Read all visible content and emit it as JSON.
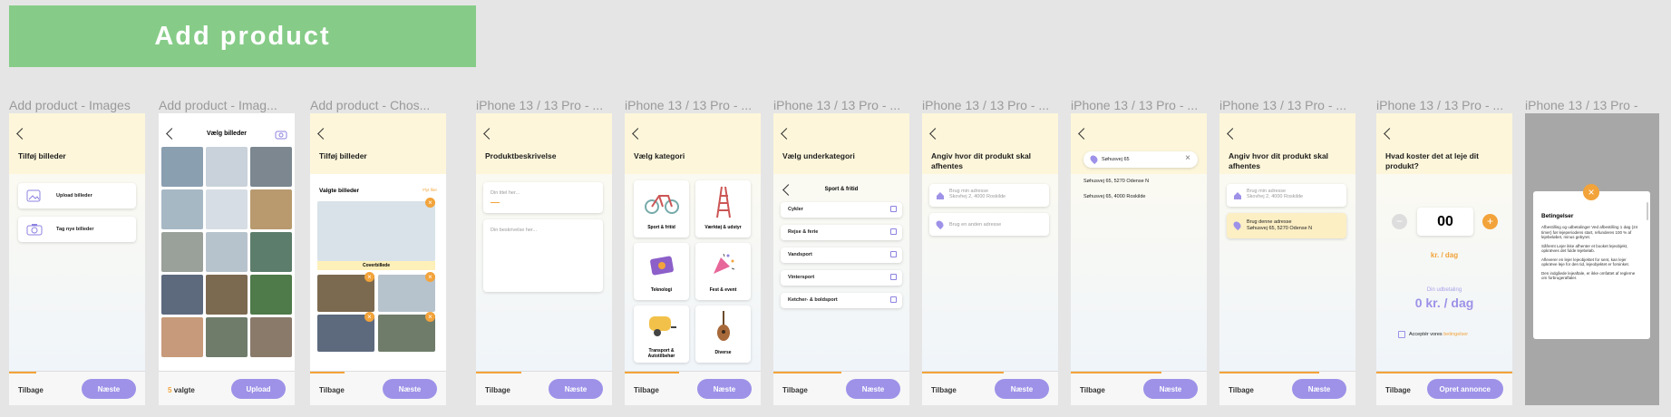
{
  "banner": "Add product",
  "frame_titles": [
    "Add product - Images",
    "Add product - Imag...",
    "Add product - Chos...",
    "iPhone 13 / 13 Pro - ...",
    "iPhone 13 / 13 Pro - ...",
    "iPhone 13 / 13 Pro - ...",
    "iPhone 13 / 13 Pro - ...",
    "iPhone 13 / 13 Pro - ...",
    "iPhone 13 / 13 Pro - ...",
    "iPhone 13 / 13 Pro - ...",
    "iPhone 13 / 13 Pro - "
  ],
  "footer": {
    "back": "Tilbage",
    "next": "Næste",
    "upload": "Upload",
    "publish": "Opret annonce",
    "selected_count": "5",
    "selected_word": "valgte"
  },
  "s1": {
    "title": "Tilføj billeder",
    "upload": "Upload billeder",
    "take": "Tag nye billeder"
  },
  "s2": {
    "title": "Vælg billeder"
  },
  "s3": {
    "title": "Tilføj billeder",
    "section": "Valgte billeder",
    "edit": "Flyt filer",
    "cover": "Coverbillede"
  },
  "s4": {
    "title": "Produktbeskrivelse",
    "title_ph": "Din titel her...",
    "desc_ph": "Din beskrivelse her..."
  },
  "s5": {
    "title": "Vælg kategori",
    "cats": [
      "Sport & fritid",
      "Værktøj & udstyr",
      "Teknologi",
      "Fest & event",
      "Transport & Autotilbehør",
      "Diverse"
    ]
  },
  "s6": {
    "title": "Vælg underkategori",
    "group": "Sport & fritid",
    "items": [
      "Cykler",
      "Rejse & ferie",
      "Vandsport",
      "Vintersport",
      "Ketcher- & boldsport"
    ]
  },
  "s7": {
    "title": "Angiv hvor dit produkt skal afhentes",
    "addr_title": "Brug min adresse",
    "addr_sub": "Skovhej 2, 4000 Roskilde",
    "other": "Brug en anden adresse"
  },
  "s8": {
    "search": "Søhusvej 65",
    "results": [
      "Søhusvej 65, 5270 Odense N",
      "Søhusvej 65, 4000 Roskilde"
    ]
  },
  "s9": {
    "title": "Angiv hvor dit produkt skal afhentes",
    "addr_title": "Brug min adresse",
    "addr_sub": "Skovhej 2, 4000 Roskilde",
    "sel_title": "Brug denne adresse",
    "sel_sub": "Søhusvej 65, 5270 Odense N"
  },
  "s10": {
    "title": "Hvad koster det at leje dit produkt?",
    "price": "00",
    "unit": "kr. / dag",
    "payout_label": "Din udbetaling",
    "payout": "0 kr. / dag",
    "accept": "Acceptér vores",
    "terms": "betingelser"
  },
  "s11": {
    "title": "Betingelser",
    "p1": "Afbestilling og udbetalinger Ved afbestilling 1 døg (24 timer) før lejeperiodens start, refunderes 100 % af lejebeløbet, minus gebyret.",
    "p2": "Såfremt Lejer ikke afhenter et booket lejeobjekt, opkræves det fulde lejebeløb.",
    "p3": "Afleverer en lejer lejeobjektet for sent, kan lejer opkræve leje for den tid, lejeobjektet er forsinket.",
    "p4": "Den indgåede lejeaftale, er ikke omfattet af reglerne om forbrugeraftaler."
  },
  "colors": {
    "accent": "#9d92e8",
    "orange": "#f2a33a",
    "header": "#fdf6da",
    "banner": "#86cc88"
  }
}
